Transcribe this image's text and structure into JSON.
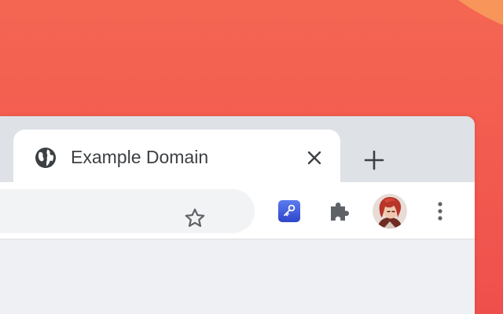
{
  "tab": {
    "title": "Example Domain",
    "favicon": "globe-icon",
    "close_icon": "close-icon"
  },
  "tabstrip": {
    "new_tab_icon": "plus-icon"
  },
  "omnibox": {
    "value": "",
    "bookmark_icon": "star-icon"
  },
  "toolbar": {
    "extension_icon": "key-icon",
    "extensions_menu_icon": "puzzle-icon",
    "profile": "avatar",
    "menu_icon": "vertical-ellipsis-icon"
  },
  "colors": {
    "wallpaper": "#f25a4f",
    "wallpaper_accent": "#f8955a",
    "tab_strip": "#dee1e6",
    "active_tab": "#ffffff",
    "omnibox": "#f1f3f4",
    "icon": "#5f6368",
    "text": "#3c4043",
    "extension_key": "#3b55d9"
  }
}
